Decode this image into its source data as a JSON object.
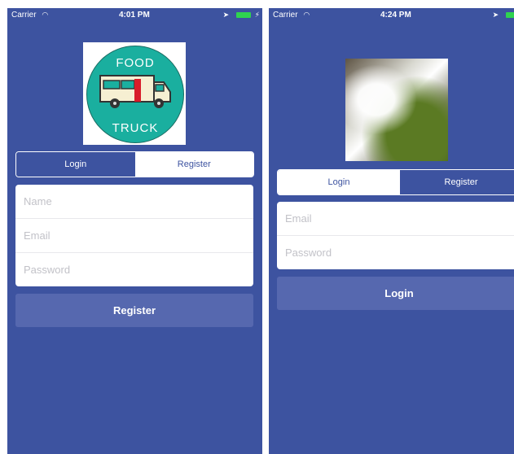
{
  "left": {
    "status": {
      "carrier": "Carrier",
      "time": "4:01 PM"
    },
    "logo": {
      "top_text": "FOOD",
      "bottom_text": "TRUCK"
    },
    "segment": {
      "login": "Login",
      "register": "Register",
      "selected": "Login"
    },
    "form": {
      "name_placeholder": "Name",
      "email_placeholder": "Email",
      "password_placeholder": "Password"
    },
    "action_label": "Register"
  },
  "right": {
    "status": {
      "carrier": "Carrier",
      "time": "4:24 PM"
    },
    "segment": {
      "login": "Login",
      "register": "Register",
      "selected": "Login"
    },
    "form": {
      "email_placeholder": "Email",
      "password_placeholder": "Password"
    },
    "action_label": "Login"
  },
  "colors": {
    "background": "#3d53a0",
    "button": "#5668af",
    "battery": "#2fd34f",
    "logo_circle": "#1aaf9f"
  },
  "icons": [
    "wifi-icon",
    "location-arrow-icon",
    "battery-icon",
    "charging-bolt-icon",
    "food-truck-illustration",
    "waterfall-photo"
  ]
}
